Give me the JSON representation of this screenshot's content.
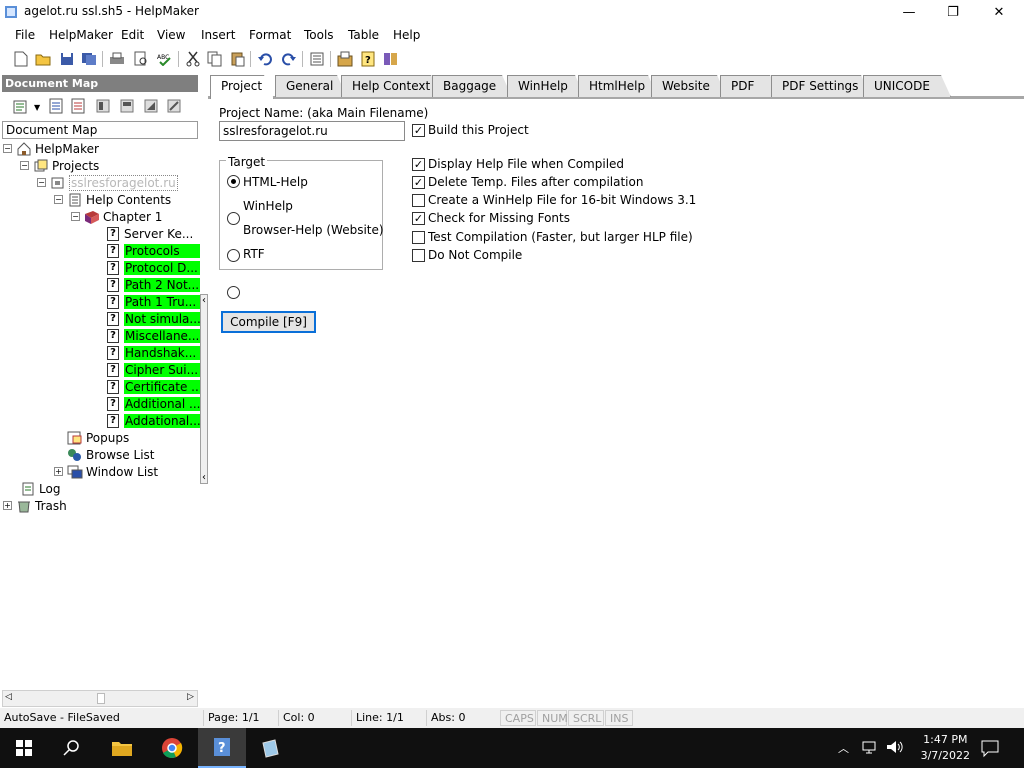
{
  "window": {
    "title": "agelot.ru ssl.sh5 - HelpMaker"
  },
  "menu": [
    "File",
    "HelpMaker",
    "Edit",
    "View",
    "Insert",
    "Format",
    "Tools",
    "Table",
    "Help"
  ],
  "left_pane": {
    "header": "Document Map",
    "label": "Document Map",
    "tree": [
      {
        "label": "HelpMaker",
        "icon": "home-icon",
        "expander": "−"
      },
      {
        "label": "Projects",
        "icon": "projects-icon",
        "expander": "−"
      },
      {
        "label": "sslresforagelot.ru",
        "icon": "project-icon",
        "expander": "−"
      },
      {
        "label": "Help Contents",
        "icon": "contents-icon",
        "expander": "−"
      },
      {
        "label": "Chapter 1",
        "icon": "book-icon",
        "expander": "−"
      },
      {
        "label": "Server Ke...",
        "icon": "topic-icon",
        "highlight": false
      },
      {
        "label": "Protocols",
        "icon": "topic-icon",
        "highlight": true
      },
      {
        "label": "Protocol D...",
        "icon": "topic-icon",
        "highlight": true
      },
      {
        "label": "Path 2 Not...",
        "icon": "topic-icon",
        "highlight": true
      },
      {
        "label": "Path 1 Tru...",
        "icon": "topic-icon",
        "highlight": true
      },
      {
        "label": "Not simula...",
        "icon": "topic-icon",
        "highlight": true
      },
      {
        "label": "Miscellane...",
        "icon": "topic-icon",
        "highlight": true
      },
      {
        "label": "Handshak...",
        "icon": "topic-icon",
        "highlight": true
      },
      {
        "label": "Cipher Sui...",
        "icon": "topic-icon",
        "highlight": true
      },
      {
        "label": "Certificate ...",
        "icon": "topic-icon",
        "highlight": true
      },
      {
        "label": "Additional ...",
        "icon": "topic-icon",
        "highlight": true
      },
      {
        "label": "Addational...",
        "icon": "topic-icon",
        "highlight": true
      },
      {
        "label": "Popups",
        "icon": "popups-icon"
      },
      {
        "label": "Browse List",
        "icon": "browse-icon"
      },
      {
        "label": "Window List",
        "icon": "window-list-icon",
        "expander": "+"
      },
      {
        "label": "Log",
        "icon": "log-icon"
      },
      {
        "label": "Trash",
        "icon": "trash-icon",
        "expander": "+"
      }
    ]
  },
  "tabs": [
    "Project",
    "General",
    "Help Context",
    "Baggage",
    "WinHelp",
    "HtmlHelp",
    "Website",
    "PDF",
    "PDF Settings",
    "UNICODE"
  ],
  "project": {
    "name_label": "Project Name: (aka Main Filename)",
    "name_value": "sslresforagelot.ru",
    "target_legend": "Target",
    "targets": [
      {
        "label": "HTML-Help",
        "selected": true
      },
      {
        "label": "WinHelp",
        "selected": false
      },
      {
        "label": "Browser-Help (Website)",
        "selected": false
      },
      {
        "label": "RTF",
        "selected": false
      }
    ],
    "build_label": "Build this Project",
    "build_checked": true,
    "options": [
      {
        "label": "Display Help File when Compiled",
        "checked": true
      },
      {
        "label": "Delete Temp. Files after compilation",
        "checked": true
      },
      {
        "label": "Create a WinHelp File for 16-bit Windows 3.1",
        "checked": false
      },
      {
        "label": "Check for Missing Fonts",
        "checked": true
      },
      {
        "label": "Test Compilation (Faster, but larger HLP file)",
        "checked": false
      },
      {
        "label": "Do Not Compile",
        "checked": false
      }
    ],
    "compile_label": "Compile [F9]"
  },
  "status": {
    "autosave": "AutoSave - FileSaved",
    "page": "Page: 1/1",
    "col": "Col: 0",
    "line": "Line: 1/1",
    "abs": "Abs: 0",
    "caps": "CAPS",
    "num": "NUM",
    "scrl": "SCRL",
    "ins": "INS"
  },
  "taskbar": {
    "time": "1:47 PM",
    "date": "3/7/2022"
  },
  "colors": {
    "highlight": "#00ff00",
    "focus_border": "#0a6fd8"
  }
}
